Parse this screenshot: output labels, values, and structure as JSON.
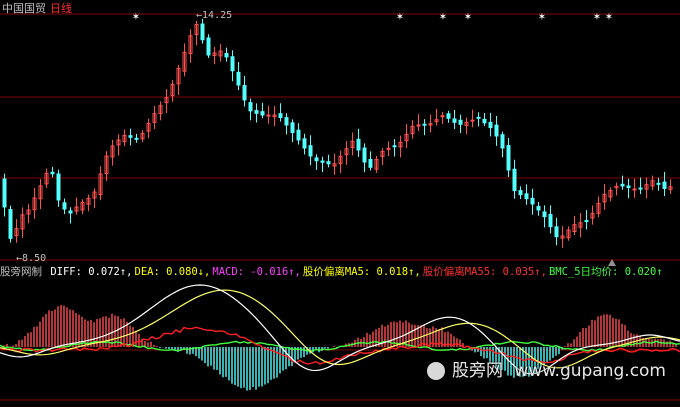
{
  "header": {
    "stock_name": "中国国贸",
    "period": "日线"
  },
  "price_chart": {
    "high_label": "14.25",
    "low_label": "8.50",
    "marker_glyph_text": "✶"
  },
  "indicator": {
    "name": "股旁网制",
    "items": [
      {
        "label": "DIFF:",
        "value": "0.072",
        "arrow": "↑",
        "color": "#ffffff"
      },
      {
        "label": "DEA:",
        "value": "0.080",
        "arrow": "↓",
        "color": "#ffff00"
      },
      {
        "label": "MACD:",
        "value": "-0.016",
        "arrow": "↑",
        "color": "#ff40ff"
      },
      {
        "label": "股价偏离MA5:",
        "value": "0.018",
        "arrow": "↑",
        "color": "#ffff00"
      },
      {
        "label": "股价偏离MA55:",
        "value": "0.035",
        "arrow": "↑",
        "color": "#ff3030"
      },
      {
        "label": "BMC_5日均价:",
        "value": "0.020",
        "arrow": "↑",
        "color": "#40ff40"
      }
    ]
  },
  "watermark": {
    "text_cn": "股旁网",
    "text_url": "www.gupang.com"
  },
  "colors": {
    "up": "#ff5050",
    "down": "#54ffff",
    "grid": "#800000",
    "diff": "#ffffff",
    "dea": "#ffff66",
    "red_line": "#ff2020",
    "green_line": "#40ff40"
  }
}
